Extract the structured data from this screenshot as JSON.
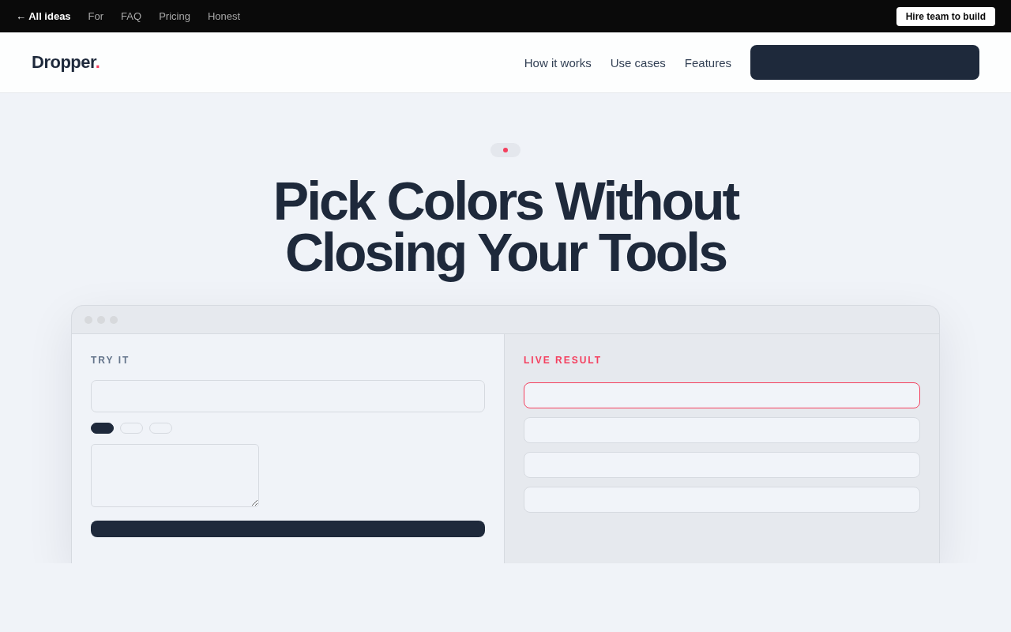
{
  "top_bar": {
    "back_link": "← All ideas",
    "links": [
      "For",
      "FAQ",
      "Pricing",
      "Honest"
    ],
    "hire_button": "Hire team to build"
  },
  "nav": {
    "logo": {
      "name": "Dropper",
      "dot": "."
    },
    "links": [
      "How it works",
      "Use cases",
      "Features"
    ]
  },
  "hero": {
    "title": "Pick Colors Without Closing Your Tools"
  },
  "demo": {
    "try_it": {
      "label": "TRY IT",
      "chips": [
        {
          "selected": true
        },
        {
          "selected": false
        },
        {
          "selected": false
        }
      ]
    },
    "live_result": {
      "label": "LIVE RESULT",
      "results": [
        {
          "selected": true
        },
        {
          "selected": false
        },
        {
          "selected": false
        },
        {
          "selected": false
        }
      ]
    }
  }
}
